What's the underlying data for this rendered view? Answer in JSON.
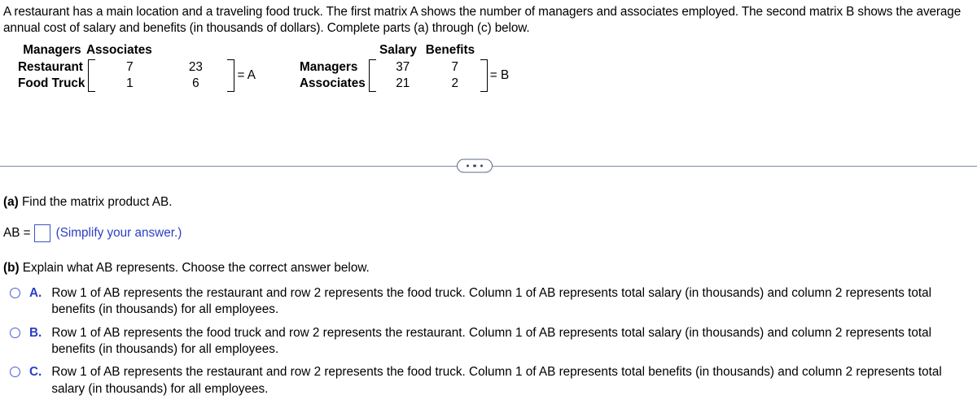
{
  "problem": {
    "statement": "A restaurant has a main location and a traveling food truck. The first matrix A shows the number of managers and associates employed. The second matrix B shows the average annual cost of salary and benefits (in thousands of dollars). Complete parts (a) through (c) below."
  },
  "matrix_a": {
    "col_headers": [
      "Managers",
      "Associates"
    ],
    "row_labels": [
      "Restaurant",
      "Food Truck"
    ],
    "rows": [
      [
        "7",
        "23"
      ],
      [
        "1",
        "6"
      ]
    ],
    "equals_label": "= A"
  },
  "matrix_b": {
    "col_headers": [
      "Salary",
      "Benefits"
    ],
    "row_labels": [
      "Managers",
      "Associates"
    ],
    "rows": [
      [
        "37",
        "7"
      ],
      [
        "21",
        "2"
      ]
    ],
    "equals_label": "= B"
  },
  "divider": {
    "expand_button_label": "•••"
  },
  "part_a": {
    "label": "(a)",
    "title": " Find the matrix product AB.",
    "answer_prefix": "AB =",
    "answer_value": "",
    "hint": "(Simplify your answer.)"
  },
  "part_b": {
    "label": "(b)",
    "title": " Explain what AB represents. Choose the correct answer below.",
    "options": [
      {
        "letter": "A.",
        "text": "Row 1 of AB represents the restaurant and row 2 represents the food truck. Column 1 of AB represents total salary (in thousands) and column 2 represents total benefits (in thousands) for all employees.",
        "selected": false
      },
      {
        "letter": "B.",
        "text": "Row 1 of AB represents the food truck and row 2 represents the restaurant. Column 1 of AB represents total salary (in thousands) and column 2 represents total benefits (in thousands) for all employees.",
        "selected": false
      },
      {
        "letter": "C.",
        "text": "Row 1 of AB represents the restaurant and row 2 represents the food truck. Column 1 of AB represents total benefits (in thousands) and column 2 represents total salary (in thousands) for all employees.",
        "selected": false
      }
    ]
  },
  "colors": {
    "link_blue": "#2b3fc4",
    "input_border": "#3a56c8",
    "divider": "#7b88a8"
  }
}
